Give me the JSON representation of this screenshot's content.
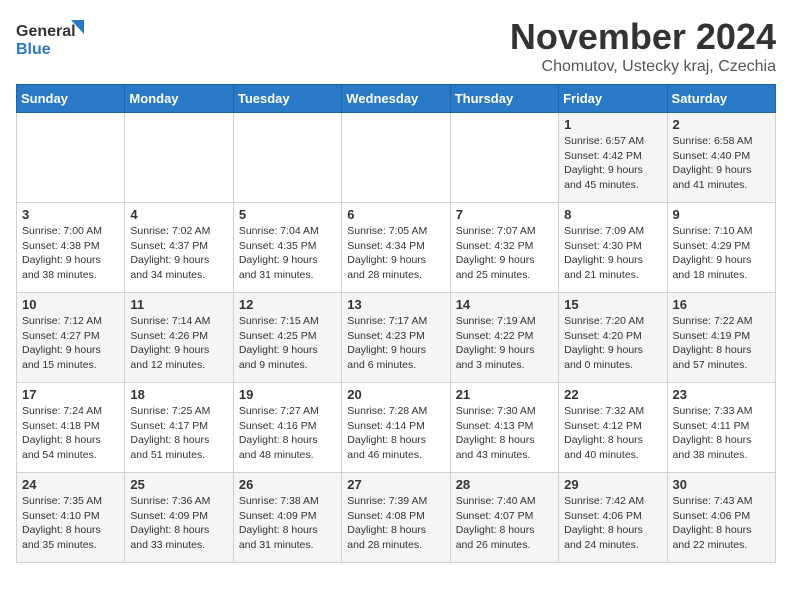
{
  "logo": {
    "line1": "General",
    "line2": "Blue"
  },
  "title": "November 2024",
  "subtitle": "Chomutov, Ustecky kraj, Czechia",
  "days_of_week": [
    "Sunday",
    "Monday",
    "Tuesday",
    "Wednesday",
    "Thursday",
    "Friday",
    "Saturday"
  ],
  "weeks": [
    [
      {
        "num": "",
        "info": ""
      },
      {
        "num": "",
        "info": ""
      },
      {
        "num": "",
        "info": ""
      },
      {
        "num": "",
        "info": ""
      },
      {
        "num": "",
        "info": ""
      },
      {
        "num": "1",
        "info": "Sunrise: 6:57 AM\nSunset: 4:42 PM\nDaylight: 9 hours and 45 minutes."
      },
      {
        "num": "2",
        "info": "Sunrise: 6:58 AM\nSunset: 4:40 PM\nDaylight: 9 hours and 41 minutes."
      }
    ],
    [
      {
        "num": "3",
        "info": "Sunrise: 7:00 AM\nSunset: 4:38 PM\nDaylight: 9 hours and 38 minutes."
      },
      {
        "num": "4",
        "info": "Sunrise: 7:02 AM\nSunset: 4:37 PM\nDaylight: 9 hours and 34 minutes."
      },
      {
        "num": "5",
        "info": "Sunrise: 7:04 AM\nSunset: 4:35 PM\nDaylight: 9 hours and 31 minutes."
      },
      {
        "num": "6",
        "info": "Sunrise: 7:05 AM\nSunset: 4:34 PM\nDaylight: 9 hours and 28 minutes."
      },
      {
        "num": "7",
        "info": "Sunrise: 7:07 AM\nSunset: 4:32 PM\nDaylight: 9 hours and 25 minutes."
      },
      {
        "num": "8",
        "info": "Sunrise: 7:09 AM\nSunset: 4:30 PM\nDaylight: 9 hours and 21 minutes."
      },
      {
        "num": "9",
        "info": "Sunrise: 7:10 AM\nSunset: 4:29 PM\nDaylight: 9 hours and 18 minutes."
      }
    ],
    [
      {
        "num": "10",
        "info": "Sunrise: 7:12 AM\nSunset: 4:27 PM\nDaylight: 9 hours and 15 minutes."
      },
      {
        "num": "11",
        "info": "Sunrise: 7:14 AM\nSunset: 4:26 PM\nDaylight: 9 hours and 12 minutes."
      },
      {
        "num": "12",
        "info": "Sunrise: 7:15 AM\nSunset: 4:25 PM\nDaylight: 9 hours and 9 minutes."
      },
      {
        "num": "13",
        "info": "Sunrise: 7:17 AM\nSunset: 4:23 PM\nDaylight: 9 hours and 6 minutes."
      },
      {
        "num": "14",
        "info": "Sunrise: 7:19 AM\nSunset: 4:22 PM\nDaylight: 9 hours and 3 minutes."
      },
      {
        "num": "15",
        "info": "Sunrise: 7:20 AM\nSunset: 4:20 PM\nDaylight: 9 hours and 0 minutes."
      },
      {
        "num": "16",
        "info": "Sunrise: 7:22 AM\nSunset: 4:19 PM\nDaylight: 8 hours and 57 minutes."
      }
    ],
    [
      {
        "num": "17",
        "info": "Sunrise: 7:24 AM\nSunset: 4:18 PM\nDaylight: 8 hours and 54 minutes."
      },
      {
        "num": "18",
        "info": "Sunrise: 7:25 AM\nSunset: 4:17 PM\nDaylight: 8 hours and 51 minutes."
      },
      {
        "num": "19",
        "info": "Sunrise: 7:27 AM\nSunset: 4:16 PM\nDaylight: 8 hours and 48 minutes."
      },
      {
        "num": "20",
        "info": "Sunrise: 7:28 AM\nSunset: 4:14 PM\nDaylight: 8 hours and 46 minutes."
      },
      {
        "num": "21",
        "info": "Sunrise: 7:30 AM\nSunset: 4:13 PM\nDaylight: 8 hours and 43 minutes."
      },
      {
        "num": "22",
        "info": "Sunrise: 7:32 AM\nSunset: 4:12 PM\nDaylight: 8 hours and 40 minutes."
      },
      {
        "num": "23",
        "info": "Sunrise: 7:33 AM\nSunset: 4:11 PM\nDaylight: 8 hours and 38 minutes."
      }
    ],
    [
      {
        "num": "24",
        "info": "Sunrise: 7:35 AM\nSunset: 4:10 PM\nDaylight: 8 hours and 35 minutes."
      },
      {
        "num": "25",
        "info": "Sunrise: 7:36 AM\nSunset: 4:09 PM\nDaylight: 8 hours and 33 minutes."
      },
      {
        "num": "26",
        "info": "Sunrise: 7:38 AM\nSunset: 4:09 PM\nDaylight: 8 hours and 31 minutes."
      },
      {
        "num": "27",
        "info": "Sunrise: 7:39 AM\nSunset: 4:08 PM\nDaylight: 8 hours and 28 minutes."
      },
      {
        "num": "28",
        "info": "Sunrise: 7:40 AM\nSunset: 4:07 PM\nDaylight: 8 hours and 26 minutes."
      },
      {
        "num": "29",
        "info": "Sunrise: 7:42 AM\nSunset: 4:06 PM\nDaylight: 8 hours and 24 minutes."
      },
      {
        "num": "30",
        "info": "Sunrise: 7:43 AM\nSunset: 4:06 PM\nDaylight: 8 hours and 22 minutes."
      }
    ]
  ]
}
